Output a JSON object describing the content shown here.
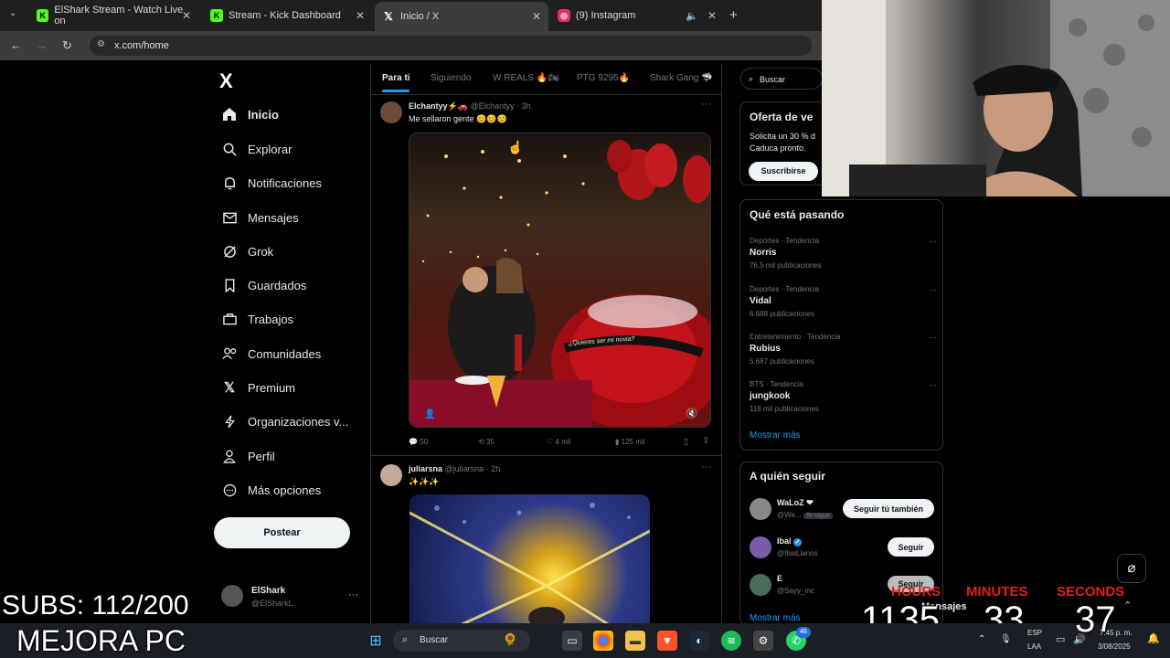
{
  "browser": {
    "tabs": [
      {
        "title": "ElShark Stream - Watch Live on",
        "favicon": "K",
        "color": "#53fc18"
      },
      {
        "title": "Stream - Kick Dashboard",
        "favicon": "K",
        "color": "#53fc18"
      },
      {
        "title": "Inicio / X",
        "favicon": "X",
        "color": "#ffffff"
      },
      {
        "title": "(9) Instagram",
        "favicon": "◎",
        "color": "#e1306c"
      }
    ],
    "url": "x.com/home"
  },
  "sidebar": {
    "logo": "X",
    "items": [
      {
        "label": "Inicio",
        "icon": "home-icon"
      },
      {
        "label": "Explorar",
        "icon": "search-icon"
      },
      {
        "label": "Notificaciones",
        "icon": "bell-icon"
      },
      {
        "label": "Mensajes",
        "icon": "mail-icon"
      },
      {
        "label": "Grok",
        "icon": "grok-icon"
      },
      {
        "label": "Guardados",
        "icon": "bookmark-icon"
      },
      {
        "label": "Trabajos",
        "icon": "briefcase-icon"
      },
      {
        "label": "Comunidades",
        "icon": "people-icon"
      },
      {
        "label": "Premium",
        "icon": "x-icon"
      },
      {
        "label": "Organizaciones v...",
        "icon": "lightning-icon"
      },
      {
        "label": "Perfil",
        "icon": "person-icon"
      },
      {
        "label": "Más opciones",
        "icon": "more-circle-icon"
      }
    ],
    "post_label": "Postear",
    "account": {
      "name": "ElShark",
      "handle": "@ElSharkL"
    }
  },
  "feed": {
    "tabs": [
      "Para ti",
      "Siguiendo",
      "W REALS 🔥🏍",
      "PTG 9295🔥",
      "Shark Gang 🦈"
    ],
    "posts": [
      {
        "author": "Elchantyy⚡🚗",
        "handle": "@Elchantyy",
        "time": "3h",
        "text": "Me sellaron gente 😊😊😊",
        "stats": {
          "replies": "50",
          "reposts": "35",
          "likes": "4 mil",
          "views": "125 mil"
        },
        "image_caption": "¿Quieres ser mi novia?"
      },
      {
        "author": "juliarsna",
        "handle": "@juliarsna",
        "time": "2h",
        "text": "✨✨✨"
      }
    ]
  },
  "right": {
    "search_placeholder": "Buscar",
    "premium": {
      "title": "Oferta de ve",
      "line1": "Solicita un 30 % d",
      "line2": "Caduca pronto.",
      "button": "Suscribirse"
    },
    "trends_title": "Qué está pasando",
    "trends": [
      {
        "cat": "Deportes · Tendencia",
        "name": "Norris",
        "count": "76,5 mil publicaciones"
      },
      {
        "cat": "Deportes · Tendencia",
        "name": "Vidal",
        "count": "6.688 publicaciones"
      },
      {
        "cat": "Entretenimiento · Tendencia",
        "name": "Rubius",
        "count": "5.687 publicaciones"
      },
      {
        "cat": "BTS · Tendencia",
        "name": "jungkook",
        "count": "118 mil publicaciones"
      }
    ],
    "show_more": "Mostrar más",
    "follow_title": "A quién seguir",
    "follow": [
      {
        "name": "WaLoZ ❤",
        "handle": "@Wa...",
        "badge": "Te sigue",
        "button": "Seguir tú también"
      },
      {
        "name": "Ibai",
        "handle": "@IbaiLlanos",
        "badge": "",
        "button": "Seguir"
      },
      {
        "name": "E",
        "handle": "@Sayy_mc",
        "badge": "",
        "button": "Seguir"
      }
    ]
  },
  "overlay": {
    "subs": "SUBS: 112/200",
    "mejora": "MEJORA PC",
    "timer": {
      "h_label": "HOURS",
      "m_label": "MINUTES",
      "s_label": "SECONDS",
      "hours": "1135",
      "minutes": "33",
      "seconds": "37"
    },
    "messages": "Mensajes"
  },
  "taskbar": {
    "search": "Buscar",
    "lang1": "ESP",
    "lang2": "LAA",
    "time": "7:45 p. m.",
    "date": "3/08/2025",
    "badge": "46"
  }
}
